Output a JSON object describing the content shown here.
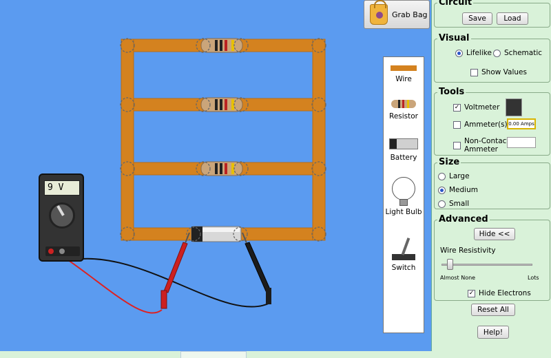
{
  "grab_bag": {
    "label": "Grab Bag",
    "icon": "shopping-bag-icon"
  },
  "toolbox": {
    "wire": "Wire",
    "resistor": "Resistor",
    "battery": "Battery",
    "bulb": "Light Bulb",
    "switch": "Switch"
  },
  "meter": {
    "reading": "9 V"
  },
  "panel": {
    "circuit": {
      "title": "Circuit",
      "save": "Save",
      "load": "Load"
    },
    "visual": {
      "title": "Visual",
      "lifelike": "Lifelike",
      "schematic": "Schematic",
      "show_values": "Show Values",
      "selected": "Lifelike"
    },
    "tools": {
      "title": "Tools",
      "voltmeter": "Voltmeter",
      "voltmeter_checked": true,
      "ammeter": "Ammeter(s)",
      "ammeter_checked": false,
      "noncontact_1": "Non-Contact",
      "noncontact_2": "Ammeter",
      "noncontact_checked": false,
      "ammeter_readout": "0.00 Amps"
    },
    "size": {
      "title": "Size",
      "large": "Large",
      "medium": "Medium",
      "small": "Small",
      "selected": "Medium"
    },
    "advanced": {
      "title": "Advanced",
      "hide": "Hide <<",
      "wire_resistivity": "Wire Resistivity",
      "min_label": "Almost None",
      "max_label": "Lots",
      "resistivity_level": 0.1,
      "hide_electrons": "Hide Electrons",
      "hide_electrons_checked": true
    },
    "reset": "Reset All",
    "help": "Help!"
  },
  "colors": {
    "canvas": "#5b9bf0",
    "panel": "#d9f2d9",
    "wire": "#d4821f"
  }
}
